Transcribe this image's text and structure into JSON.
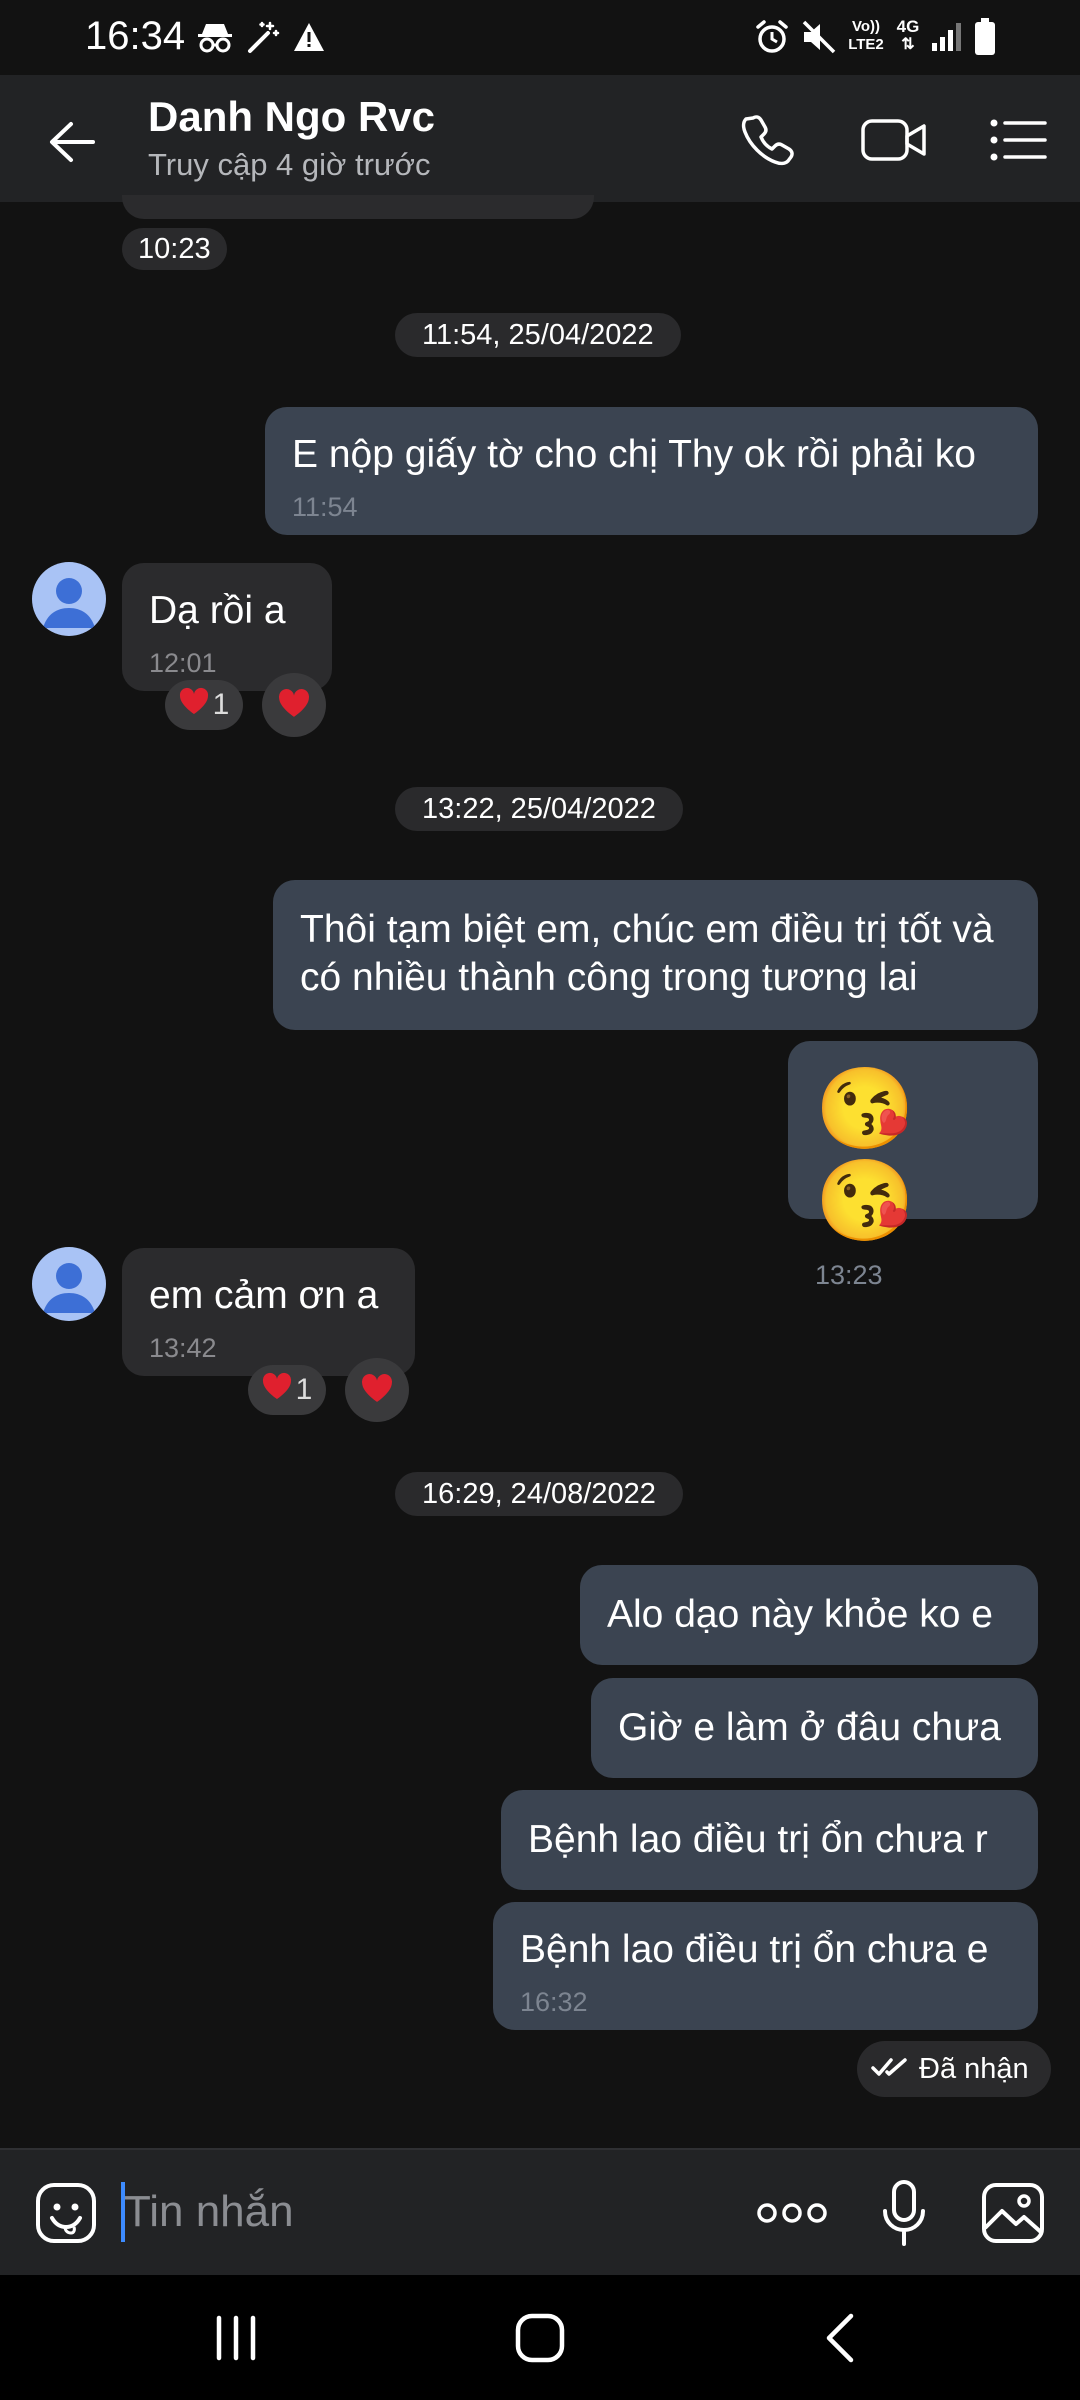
{
  "status_bar": {
    "time": "16:34",
    "left_icons": [
      "incognito-icon",
      "magic-wand-icon",
      "warning-icon"
    ],
    "right_icons": [
      "alarm-icon",
      "mute-icon",
      "volte-icon",
      "4g-icon",
      "signal-icon",
      "battery-icon"
    ],
    "volte_label": "Vo))",
    "volte_sub": "LTE2",
    "network_label": "4G"
  },
  "header": {
    "contact_name": "Danh Ngo Rvc",
    "contact_status": "Truy cập 4 giờ trước",
    "icons": [
      "back-arrow-icon",
      "phone-icon",
      "video-call-icon",
      "menu-list-icon"
    ]
  },
  "conversation": {
    "top_time": "10:23",
    "date_separators": [
      "11:54, 25/04/2022",
      "13:22, 25/04/2022",
      "16:29, 24/08/2022"
    ],
    "messages": [
      {
        "direction": "out",
        "text": "E nộp giấy tờ cho chị Thy ok rồi phải ko",
        "time": "11:54"
      },
      {
        "direction": "in",
        "text": "Dạ rồi a",
        "time": "12:01",
        "reaction": "❤️",
        "reaction_count": "1"
      },
      {
        "direction": "out",
        "text": "Thôi tạm biệt em, chúc em điều trị tốt và có nhiều thành công trong tương lai",
        "time": ""
      },
      {
        "direction": "out",
        "text": "😘😘",
        "time": "13:23"
      },
      {
        "direction": "in",
        "text": "em cảm ơn a",
        "time": "13:42",
        "reaction": "❤️",
        "reaction_count": "1"
      },
      {
        "direction": "out",
        "text": "Alo dạo này khỏe ko e",
        "time": ""
      },
      {
        "direction": "out",
        "text": "Giờ e làm ở đâu chưa",
        "time": ""
      },
      {
        "direction": "out",
        "text": "Bệnh lao điều trị ổn chưa r",
        "time": ""
      },
      {
        "direction": "out",
        "text": "Bệnh lao điều trị ổn chưa e",
        "time": "16:32"
      }
    ],
    "delivery_status": "Đã nhận"
  },
  "composer": {
    "placeholder": "Tin nhắn",
    "value": "",
    "icons": [
      "emoji-sticker-icon",
      "more-options-icon",
      "microphone-icon",
      "image-gallery-icon"
    ]
  },
  "nav_bar": {
    "icons": [
      "recent-apps-icon",
      "home-icon",
      "back-icon"
    ]
  },
  "colors": {
    "background": "#121212",
    "header": "#222325",
    "outgoing_bubble": "#3b4451",
    "incoming_bubble": "#2b2b2d",
    "accent": "#3d8bff"
  }
}
